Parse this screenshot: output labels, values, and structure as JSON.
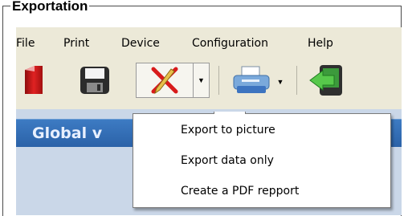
{
  "frame": {
    "title": "Exportation"
  },
  "menubar": {
    "items": [
      {
        "label": "File"
      },
      {
        "label": "Print"
      },
      {
        "label": "Device"
      },
      {
        "label": "Configuration"
      },
      {
        "label": "Help"
      }
    ]
  },
  "toolbar": {
    "buttons": [
      {
        "icon": "red-document-icon"
      },
      {
        "icon": "floppy-disk-icon"
      },
      {
        "icon": "pencil-cross-icon"
      },
      {
        "icon": "printer-icon"
      },
      {
        "icon": "green-arrow-device-icon"
      }
    ]
  },
  "panel": {
    "title": "Global v"
  },
  "export_menu": {
    "options": [
      {
        "label": "Export to picture"
      },
      {
        "label": "Export data only"
      },
      {
        "label": "Create a PDF repport"
      }
    ]
  },
  "colors": {
    "panel_header": "#2b62a8",
    "panel_body": "#cad7e8",
    "toolbar_bg": "#ece9d8"
  }
}
